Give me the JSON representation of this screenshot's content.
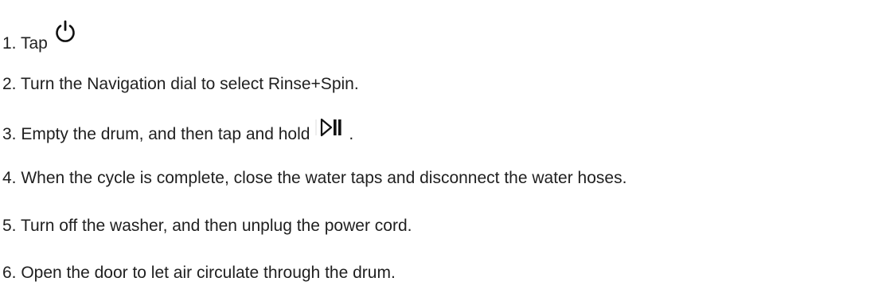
{
  "steps": [
    {
      "label": "1. Tap",
      "icon": "power-icon",
      "suffix": ""
    },
    {
      "label": "2. Turn the Navigation dial to select Rinse+Spin.",
      "icon": "",
      "suffix": ""
    },
    {
      "label": "3. Empty the drum, and then tap and hold",
      "icon": "play-pause-icon",
      "suffix": "."
    },
    {
      "label": "4. When the cycle is complete, close the water taps and disconnect the water hoses.",
      "icon": "",
      "suffix": ""
    },
    {
      "label": "5. Turn off the washer, and then unplug the power cord.",
      "icon": "",
      "suffix": ""
    },
    {
      "label": "6. Open the door to let air circulate through the drum.",
      "icon": "",
      "suffix": ""
    }
  ]
}
